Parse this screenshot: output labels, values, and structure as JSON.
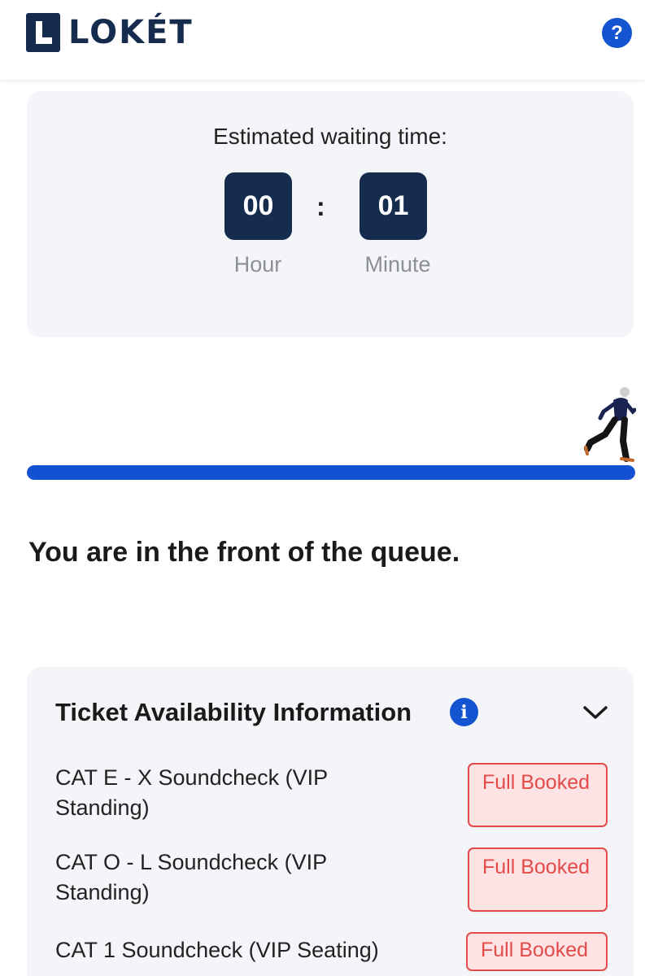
{
  "header": {
    "logo_text": "LOKÉT",
    "help_label": "?"
  },
  "waiting": {
    "label": "Estimated waiting time:",
    "hours": "00",
    "minutes": "01",
    "separator": ":",
    "hour_label": "Hour",
    "minute_label": "Minute"
  },
  "queue": {
    "progress_percent": 100,
    "message": "You are in the front of the queue."
  },
  "availability": {
    "title": "Ticket Availability Information",
    "info_icon": "i",
    "tickets": [
      {
        "name": "CAT E - X Soundcheck (VIP Standing)",
        "status": "Full Booked"
      },
      {
        "name": "CAT O - L Soundcheck (VIP Standing)",
        "status": "Full Booked"
      },
      {
        "name": "CAT 1 Soundcheck (VIP Seating)",
        "status": "Full Booked"
      }
    ]
  },
  "colors": {
    "brand_navy": "#152c4e",
    "accent_blue": "#1454d0",
    "status_red": "#e34b4b"
  },
  "icons": [
    "loket-logo-icon",
    "help-icon",
    "runner-icon",
    "info-icon",
    "chevron-down-icon"
  ]
}
